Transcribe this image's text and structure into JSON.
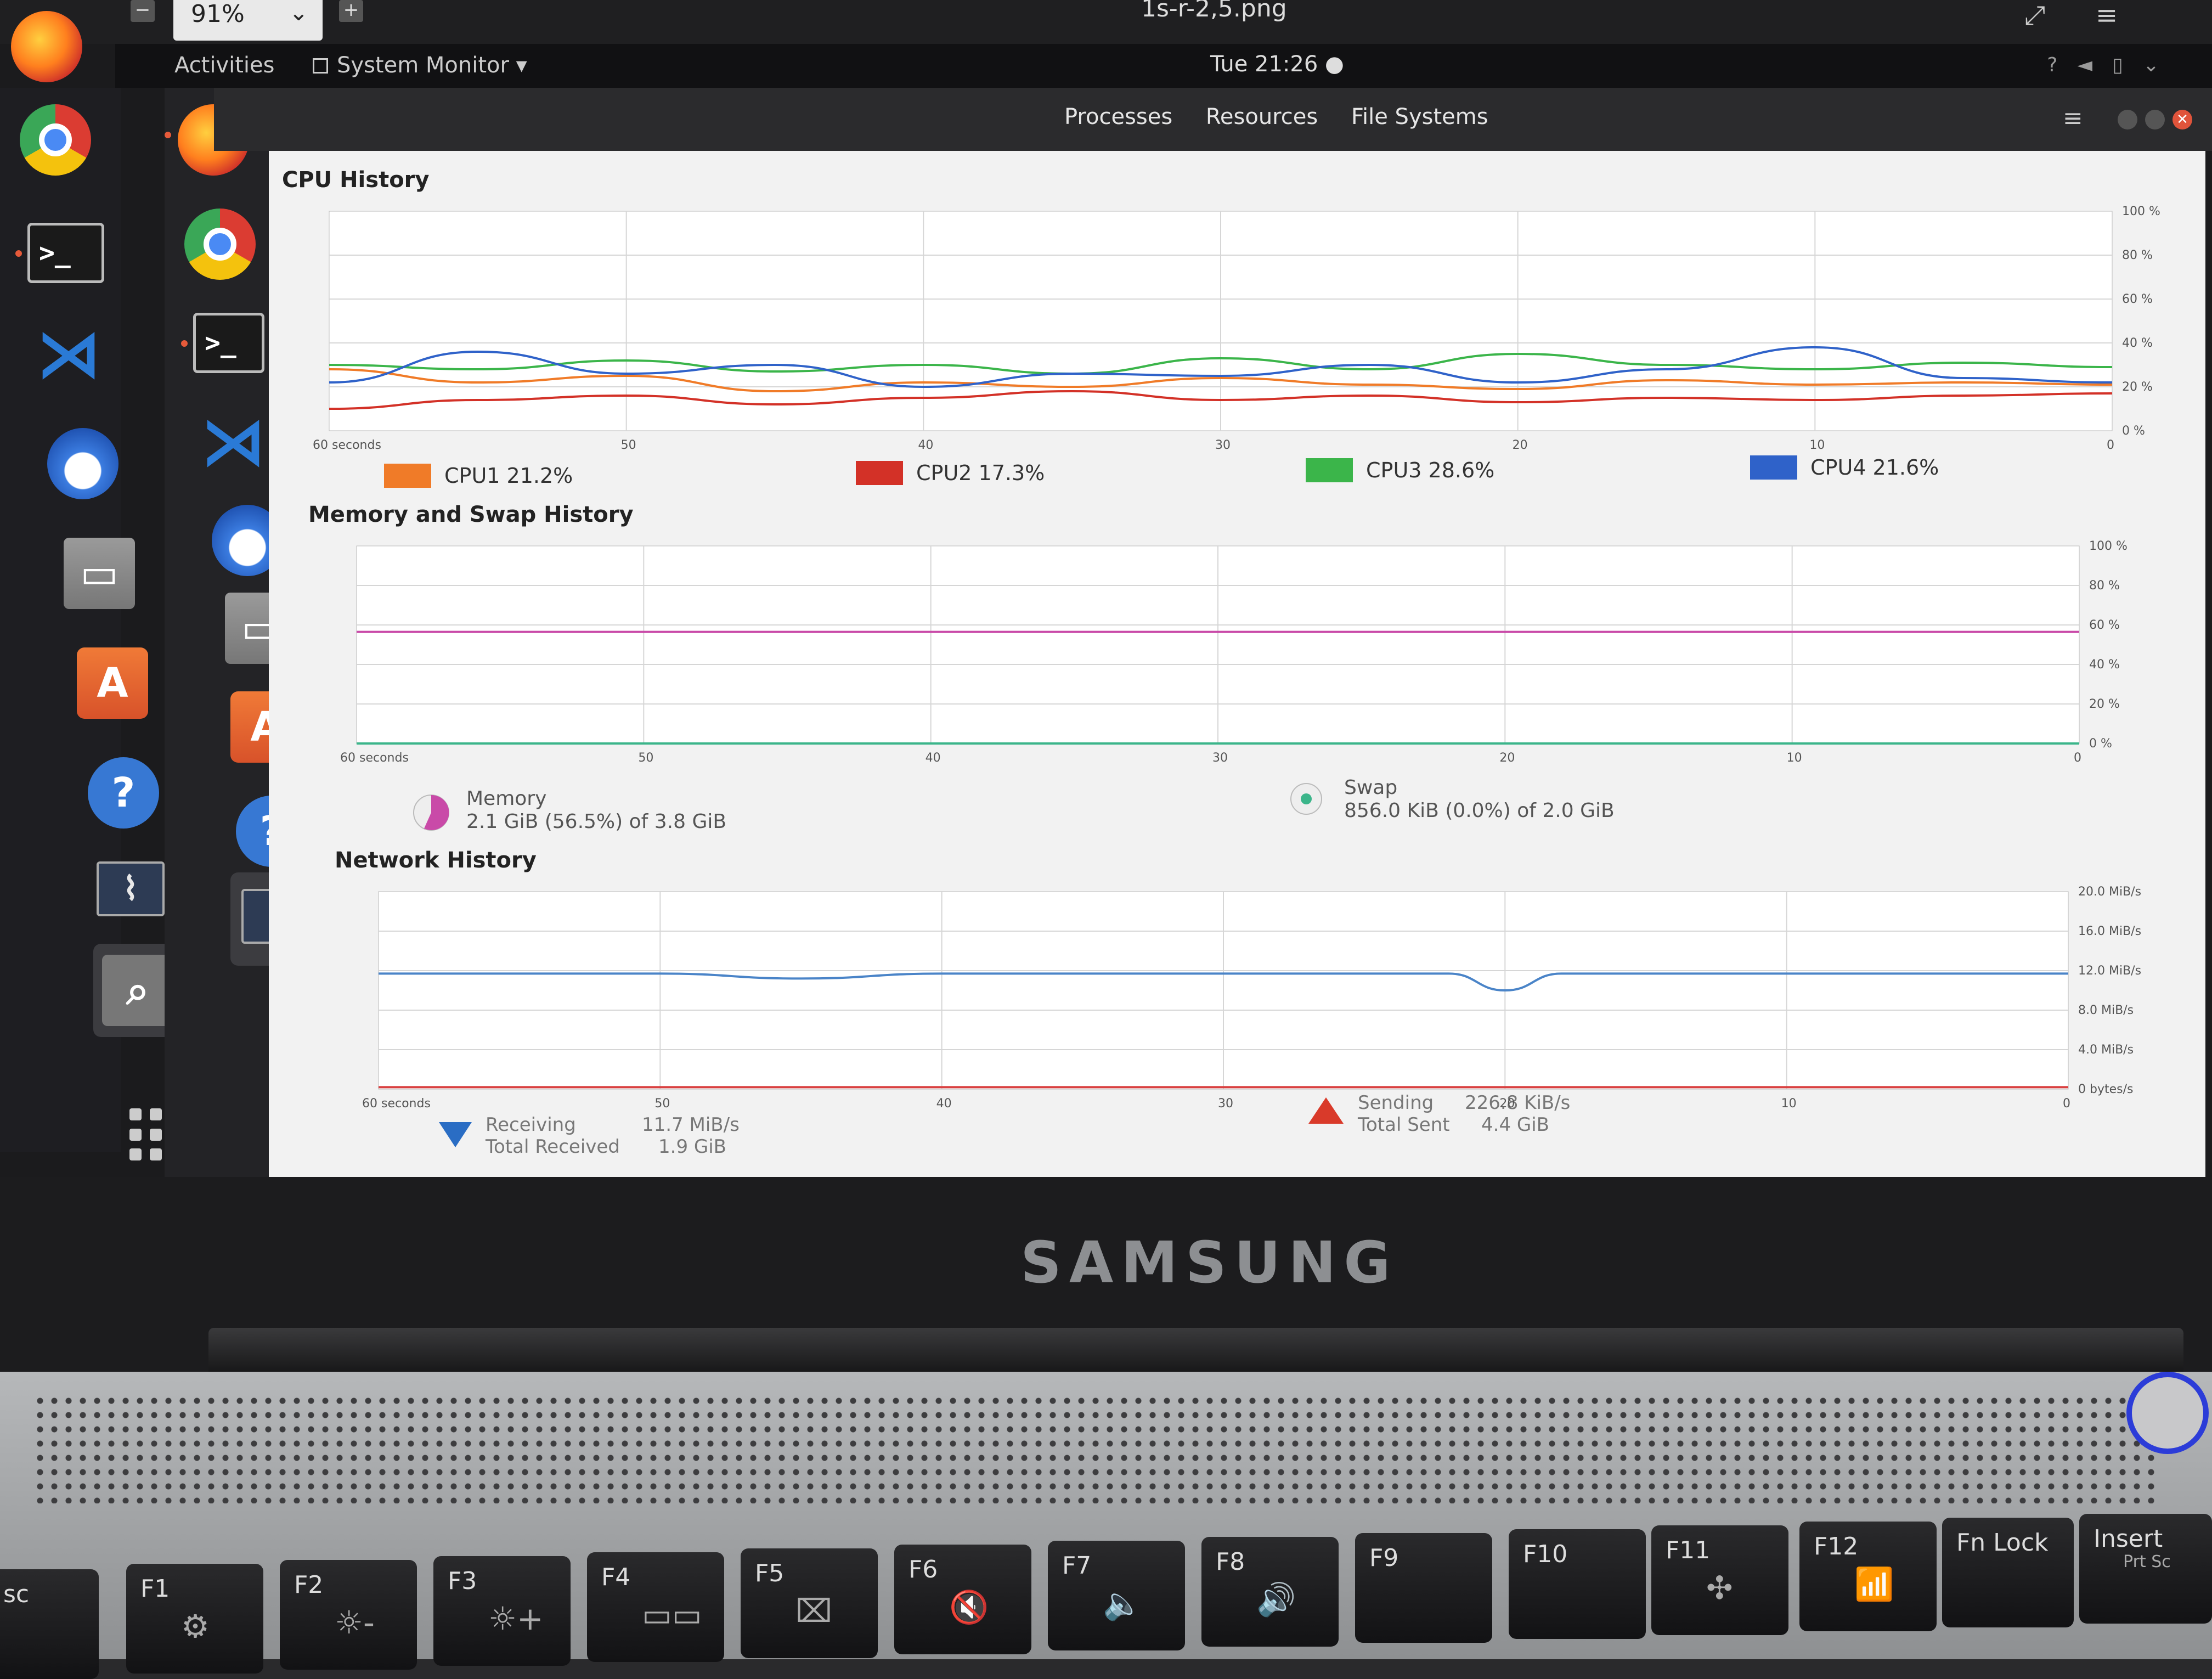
{
  "viewer": {
    "zoom": "91%",
    "file_name": "1s-r-2,5.png"
  },
  "topbar": {
    "activities": "Activities",
    "app_menu": "System Monitor ▾",
    "clock": "Tue 21:26 ●"
  },
  "tabs": [
    "Processes",
    "Resources",
    "File Systems"
  ],
  "dock_icons": [
    "firefox-icon",
    "chrome-icon",
    "terminal-icon",
    "vscode-icon",
    "thunderbird-icon",
    "files-icon",
    "software-store-icon",
    "help-icon",
    "system-monitor-icon",
    "image-viewer-icon",
    "app-grid-icon"
  ],
  "cpu": {
    "title": "CPU History",
    "ylabels": [
      "100 %",
      "80 %",
      "60 %",
      "40 %",
      "20 %",
      "0 %"
    ],
    "xlabels": [
      "60 seconds",
      "50",
      "40",
      "30",
      "20",
      "10",
      "0"
    ],
    "legend": [
      {
        "label": "CPU1 21.2%",
        "color": "#f07b28"
      },
      {
        "label": "CPU2 17.3%",
        "color": "#d33127"
      },
      {
        "label": "CPU3 28.6%",
        "color": "#3bb54a"
      },
      {
        "label": "CPU4 21.6%",
        "color": "#2f62c9"
      }
    ]
  },
  "memory": {
    "title": "Memory and Swap History",
    "ylabels": [
      "100 %",
      "80 %",
      "60 %",
      "40 %",
      "20 %",
      "0 %"
    ],
    "xlabels": [
      "60 seconds",
      "50",
      "40",
      "30",
      "20",
      "10",
      "0"
    ],
    "memory_label": "Memory",
    "memory_value": "2.1 GiB (56.5%) of 3.8 GiB",
    "swap_label": "Swap",
    "swap_value": "856.0 KiB (0.0%) of 2.0 GiB",
    "memory_color": "#c94aa8",
    "swap_color": "#3bb58a"
  },
  "network": {
    "title": "Network History",
    "ylabels": [
      "20.0 MiB/s",
      "16.0 MiB/s",
      "12.0 MiB/s",
      "8.0 MiB/s",
      "4.0 MiB/s",
      "0 bytes/s"
    ],
    "xlabels": [
      "60 seconds",
      "50",
      "40",
      "30",
      "20",
      "10",
      "0"
    ],
    "receiving_label": "Receiving",
    "receiving_value": "11.7 MiB/s",
    "total_received_label": "Total Received",
    "total_received_value": "1.9 GiB",
    "sending_label": "Sending",
    "sending_value": "226.8 KiB/s",
    "total_sent_label": "Total Sent",
    "total_sent_value": "4.4 GiB",
    "receive_color": "#4a84c8",
    "send_color": "#d94040"
  },
  "chart_data": [
    {
      "type": "line",
      "title": "CPU History",
      "xlabel": "",
      "ylabel": "",
      "x": [
        60,
        55,
        50,
        45,
        40,
        35,
        30,
        25,
        20,
        15,
        10,
        5,
        0
      ],
      "xlim": [
        60,
        0
      ],
      "ylim": [
        0,
        100
      ],
      "series": [
        {
          "name": "CPU1 21.2%",
          "color": "#f07b28",
          "values": [
            28,
            22,
            25,
            18,
            22,
            20,
            24,
            21,
            19,
            23,
            21,
            22,
            21
          ]
        },
        {
          "name": "CPU2 17.3%",
          "color": "#d33127",
          "values": [
            10,
            14,
            16,
            12,
            15,
            18,
            14,
            16,
            13,
            15,
            14,
            16,
            17
          ]
        },
        {
          "name": "CPU3 28.6%",
          "color": "#3bb54a",
          "values": [
            30,
            28,
            32,
            27,
            30,
            26,
            33,
            28,
            35,
            30,
            28,
            31,
            29
          ]
        },
        {
          "name": "CPU4 21.6%",
          "color": "#2f62c9",
          "values": [
            22,
            36,
            26,
            30,
            20,
            26,
            25,
            30,
            22,
            28,
            38,
            24,
            22
          ]
        }
      ]
    },
    {
      "type": "line",
      "title": "Memory and Swap History",
      "xlabel": "",
      "ylabel": "",
      "x": [
        60,
        50,
        40,
        30,
        20,
        10,
        0
      ],
      "xlim": [
        60,
        0
      ],
      "ylim": [
        0,
        100
      ],
      "series": [
        {
          "name": "Memory",
          "color": "#c94aa8",
          "values": [
            56.5,
            56.5,
            56.5,
            56.5,
            56.5,
            56.5,
            56.5
          ]
        },
        {
          "name": "Swap",
          "color": "#3bb58a",
          "values": [
            0,
            0,
            0,
            0,
            0,
            0,
            0
          ]
        }
      ]
    },
    {
      "type": "line",
      "title": "Network History",
      "xlabel": "",
      "ylabel": "MiB/s",
      "x": [
        60,
        50,
        45,
        40,
        30,
        22,
        20,
        18,
        10,
        0
      ],
      "xlim": [
        60,
        0
      ],
      "ylim": [
        0,
        20
      ],
      "series": [
        {
          "name": "Receiving",
          "color": "#4a84c8",
          "values": [
            11.7,
            11.7,
            11.2,
            11.7,
            11.7,
            11.7,
            10.0,
            11.7,
            11.7,
            11.7
          ]
        },
        {
          "name": "Sending",
          "color": "#d94040",
          "values": [
            0.2,
            0.2,
            0.2,
            0.2,
            0.2,
            0.2,
            0.2,
            0.2,
            0.2,
            0.2
          ]
        }
      ]
    }
  ],
  "laptop": {
    "brand": "SAMSUNG",
    "keys": [
      "sc",
      "F1",
      "F2",
      "F3",
      "F4",
      "F5",
      "F6",
      "F7",
      "F8",
      "F9",
      "F10",
      "F11",
      "F12",
      "Fn Lock",
      "Insert"
    ],
    "key_sub": [
      "",
      "⚙",
      "☼-",
      "☼+",
      "▭▭",
      "⌧",
      "🔇",
      "🔈",
      "🔊",
      "",
      "",
      "✣",
      "📶",
      "",
      "Prt Sc"
    ]
  }
}
